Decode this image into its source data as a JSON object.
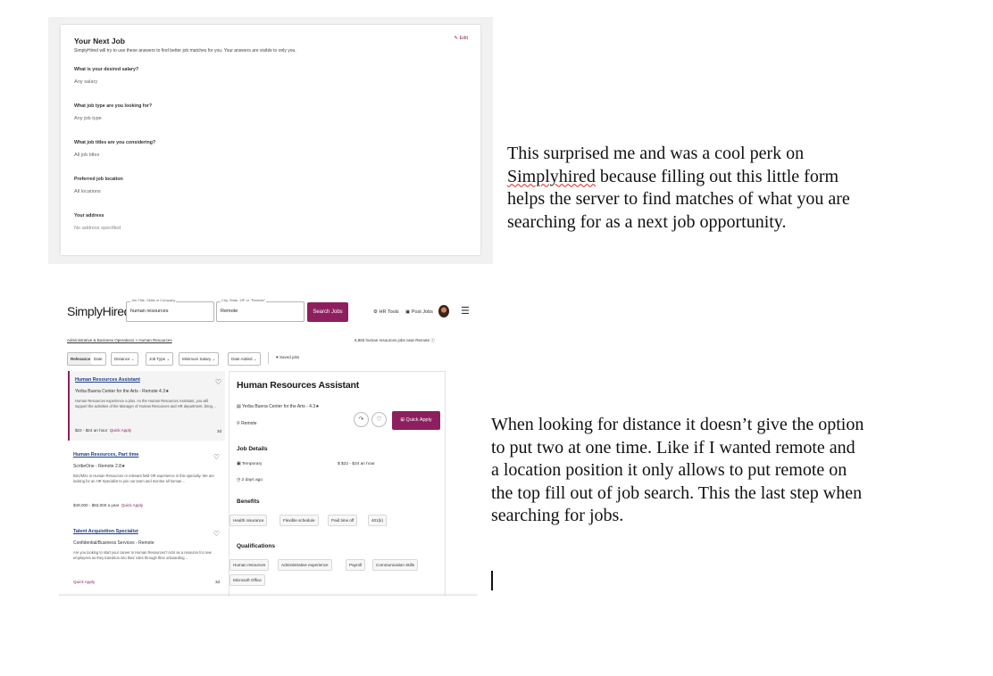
{
  "next_job": {
    "title": "Your Next Job",
    "subtitle": "SimplyHired will try to use these answers to find better job matches for you. Your answers are visible to only you.",
    "edit_label": "Edit",
    "questions": [
      {
        "q": "What is your desired salary?",
        "a": "Any salary"
      },
      {
        "q": "What job type are you looking for?",
        "a": "Any job type"
      },
      {
        "q": "What job titles are you considering?",
        "a": "All job titles"
      },
      {
        "q": "Preferred job location",
        "a": "All locations"
      },
      {
        "q": "Your address",
        "a": "No address specified"
      }
    ]
  },
  "simplyhired": {
    "logo": "SimplyHired",
    "search": {
      "what_label": "Job Title, Skills or Company",
      "what_value": "human resources",
      "where_label": "City, State, ZIP or \"Remote\"",
      "where_value": "Remote",
      "button": "Search Jobs"
    },
    "tools": {
      "hr_tools": "HR Tools",
      "post_jobs": "Post Jobs"
    },
    "breadcrumb": "Administrative & Business Operations > Human Resources",
    "result_count": "6,983 human resources jobs near Remote",
    "filters": [
      "Relevance",
      "Date",
      "Distance",
      "Job Type",
      "Minimum Salary",
      "Date Added"
    ],
    "saved_jobs": "Saved jobs",
    "jobs": [
      {
        "title": "Human Resources Assistant",
        "company": "Yerba Buena Center for the Arts - Remote  4.3★",
        "desc": "Human Resources experience a plus. As the Human Resources Assistant, you will support the activities of the Manager of Human Resources and HR department, bring…",
        "pay": "$22 - $24 an hour",
        "quick": "Quick Apply",
        "age": "3d"
      },
      {
        "title": "Human Resources, Part time",
        "company": "ScribeOne - Remote  2.8★",
        "desc": "BSc/MSc in Human Resources or relevant field OR experience in this specialty. We are looking for an HR Specialist to join our team and monitor all human…",
        "pay": "$49,000 - $63,000 a year",
        "quick": "Quick Apply",
        "age": ""
      },
      {
        "title": "Talent Acquisition Specialist",
        "company": "Confidential/Business Services - Remote",
        "desc": "Are you looking to start your career in Human Resources? Acts as a resource for new employees as they transition into their roles through their onboarding…",
        "pay": "",
        "quick": "Quick Apply",
        "age": "3d"
      }
    ],
    "detail": {
      "title": "Human Resources Assistant",
      "company": "Yerba Buena Center for the Arts -  4.3★",
      "location": "Remote",
      "quick_apply": "Quick Apply",
      "job_details_heading": "Job Details",
      "job_type": "Temporary",
      "pay": "$22 - $24 an hour",
      "posted": "2 days ago",
      "benefits_heading": "Benefits",
      "benefits": [
        "Health insurance",
        "Flexible schedule",
        "Paid time off",
        "401(k)"
      ],
      "qualifications_heading": "Qualifications",
      "qualifications": [
        "Human resources",
        "Administrative experience",
        "Payroll",
        "Communication skills",
        "Microsoft Office"
      ]
    }
  },
  "paragraphs": {
    "p1_a": "This surprised me and was a cool perk on",
    "p1_b": "Simplyhired",
    "p1_c": " because filling out this little form",
    "p1_d": "helps the server to find matches of what you are",
    "p1_e": "searching for as a next job opportunity.",
    "p2_a": "When looking for distance it doesn’t give the option",
    "p2_b": "to put two at one time. Like if I wanted remote and",
    "p2_c": "a location position it only allows to put remote on",
    "p2_d": "the top fill out of job search. This the last step when",
    "p2_e": "searching for jobs."
  },
  "colors": {
    "brand": "#8e1f5f",
    "link": "#1c3b8a"
  }
}
